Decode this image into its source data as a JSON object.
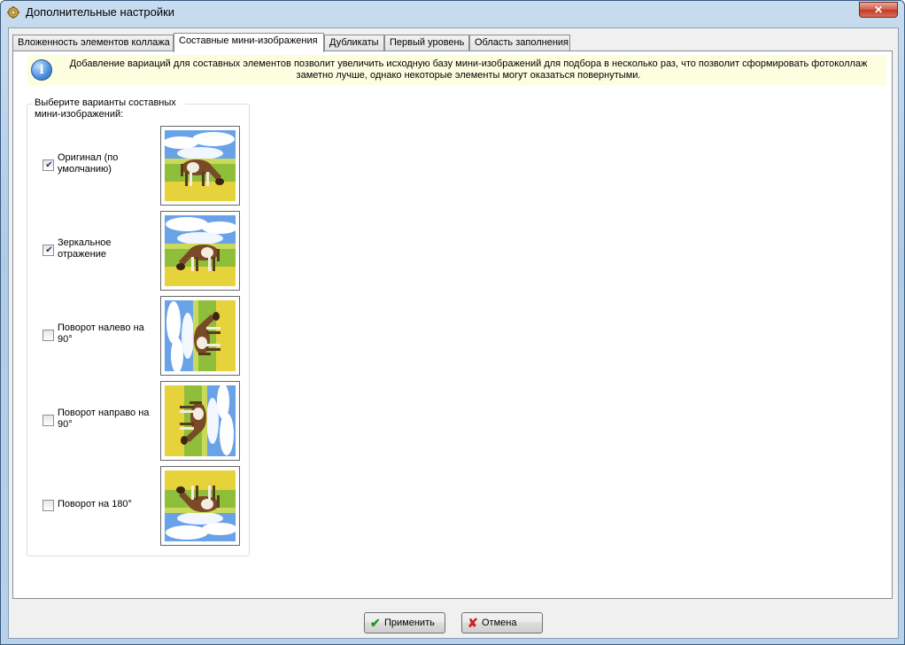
{
  "window": {
    "title": "Дополнительные настройки",
    "close_glyph": "✕"
  },
  "tabs": [
    {
      "label": "Вложенность элементов коллажа",
      "active": false
    },
    {
      "label": "Составные мини-изображения",
      "active": true
    },
    {
      "label": "Дубликаты",
      "active": false
    },
    {
      "label": "Первый уровень",
      "active": false
    },
    {
      "label": "Область заполнения",
      "active": false
    }
  ],
  "info": {
    "icon": "info-icon",
    "text": "Добавление вариаций для составных элементов позволит увеличить исходную базу мини-изображений для подбора в несколько раз, что позволит сформировать фотоколлаж заметно лучше, однако некоторые элементы могут оказаться повернутыми."
  },
  "group": {
    "title": "Выберите варианты составных мини-изображений:",
    "options": [
      {
        "label": "Оригинал (по умолчанию)",
        "checked": true,
        "transform": "original"
      },
      {
        "label": "Зеркальное отражение",
        "checked": true,
        "transform": "mirror"
      },
      {
        "label": "Поворот налево на 90°",
        "checked": false,
        "transform": "rotate-left-90"
      },
      {
        "label": "Поворот направо на 90°",
        "checked": false,
        "transform": "rotate-right-90"
      },
      {
        "label": "Поворот на 180°",
        "checked": false,
        "transform": "rotate-180"
      }
    ]
  },
  "buttons": {
    "apply": {
      "label": "Применить",
      "icon": "checkmark-icon",
      "color": "#1e9a1e"
    },
    "cancel": {
      "label": "Отмена",
      "icon": "cross-icon",
      "color": "#d42020"
    }
  }
}
